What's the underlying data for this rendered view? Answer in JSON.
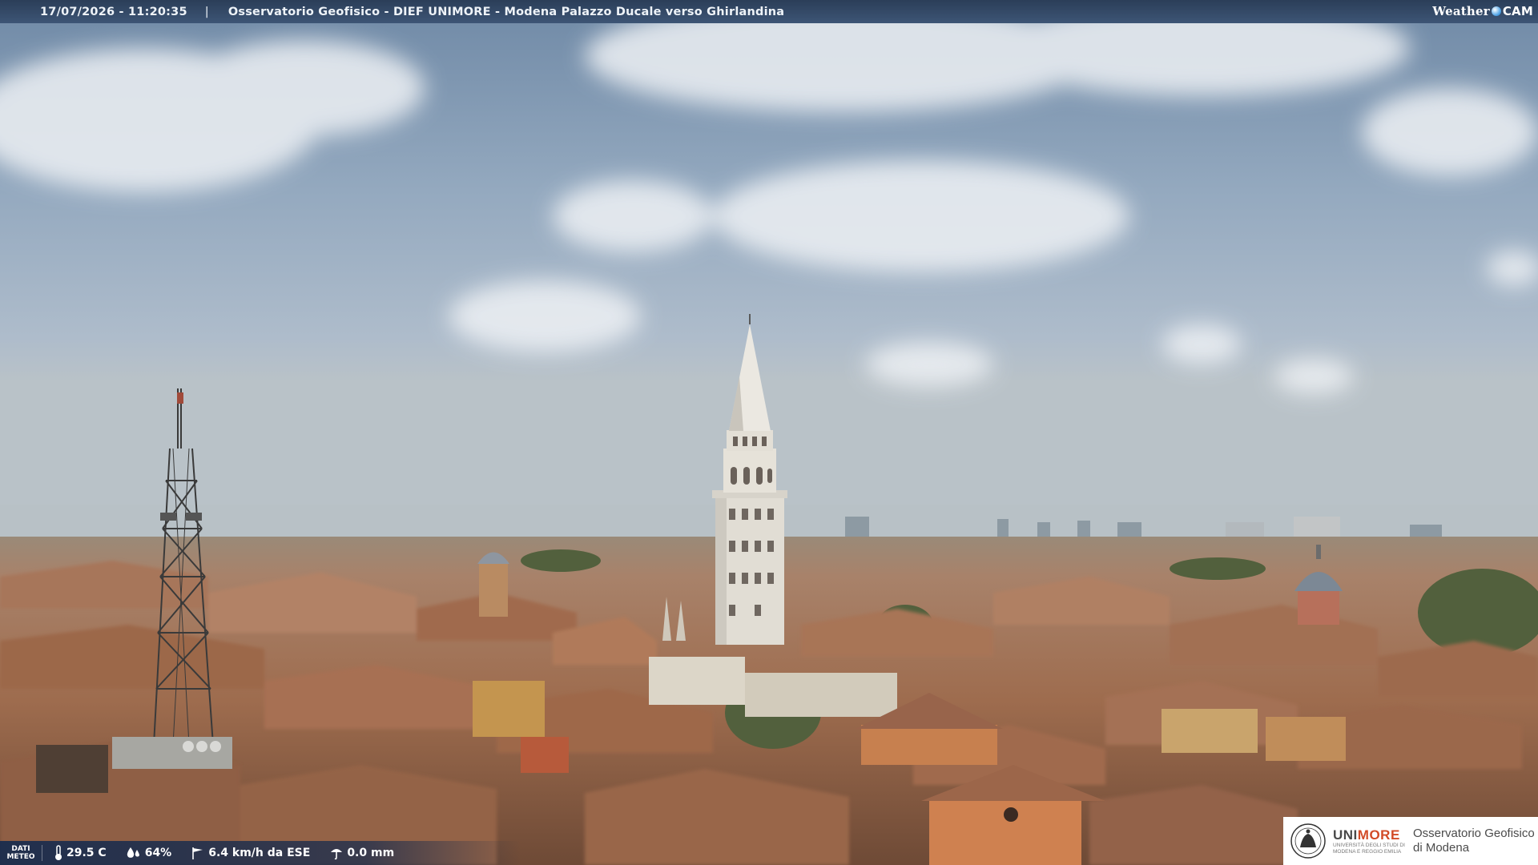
{
  "header": {
    "datetime": "17/07/2026 - 11:20:35",
    "separator": "|",
    "title": "Osservatorio Geofisico - DIEF UNIMORE - Modena Palazzo Ducale verso Ghirlandina",
    "logo": {
      "weather": "Weather",
      "cam": "CAM"
    }
  },
  "weather": {
    "label_line1": "DATI",
    "label_line2": "METEO",
    "temperature": "29.5 C",
    "humidity": "64%",
    "wind": "6.4 km/h da ESE",
    "rain": "0.0 mm",
    "icons": [
      "thermometer-icon",
      "humidity-icon",
      "wind-icon",
      "rain-gauge-icon"
    ]
  },
  "badge": {
    "uni": "UNI",
    "more": "MORE",
    "sub": "UNIVERSITÀ DEGLI STUDI DI MODENA E REGGIO EMILIA",
    "line1": "Osservatorio Geofisico",
    "line2": "di Modena",
    "accent": "#d24b27"
  }
}
